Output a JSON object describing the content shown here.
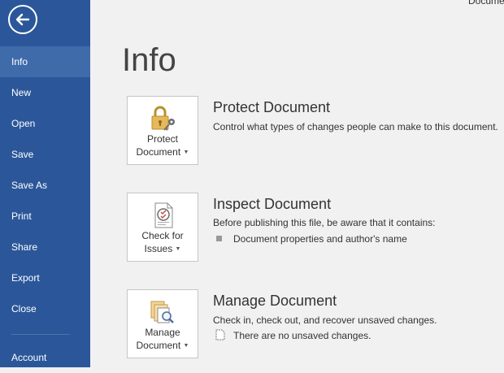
{
  "window": {
    "doc_title_partial": "Docume"
  },
  "sidebar": {
    "items": [
      {
        "label": "Info"
      },
      {
        "label": "New"
      },
      {
        "label": "Open"
      },
      {
        "label": "Save"
      },
      {
        "label": "Save As"
      },
      {
        "label": "Print"
      },
      {
        "label": "Share"
      },
      {
        "label": "Export"
      },
      {
        "label": "Close"
      },
      {
        "label": "Account"
      }
    ]
  },
  "main": {
    "title": "Info",
    "sections": [
      {
        "button_line1": "Protect",
        "button_line2": "Document",
        "title": "Protect Document",
        "description": "Control what types of changes people can make to this document."
      },
      {
        "button_line1": "Check for",
        "button_line2": "Issues",
        "title": "Inspect Document",
        "description": "Before publishing this file, be aware that it contains:",
        "bullet": "Document properties and author's name"
      },
      {
        "button_line1": "Manage",
        "button_line2": "Document",
        "title": "Manage Document",
        "description": "Check in, check out, and recover unsaved changes.",
        "note": "There are no unsaved changes."
      }
    ]
  },
  "colors": {
    "sidebar": "#2b579a",
    "sidebar_active": "#3f6bab",
    "background": "#f1f1f1"
  },
  "icons": [
    "back-arrow-icon",
    "lock-key-icon",
    "inspect-document-icon",
    "manage-document-icon",
    "unsaved-document-icon"
  ]
}
